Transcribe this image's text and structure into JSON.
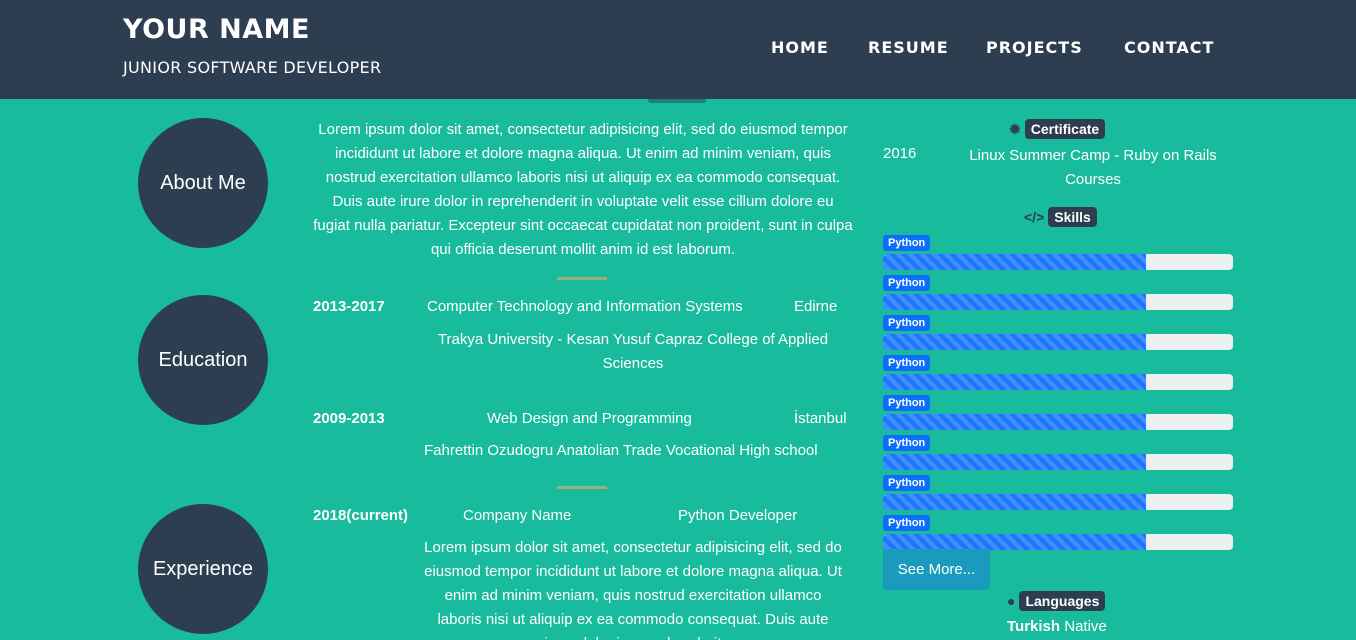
{
  "header": {
    "name": "YOUR NAME",
    "subtitle": "JUNIOR SOFTWARE DEVELOPER",
    "nav": [
      "HOME",
      "RESUME",
      "PROJECTS",
      "CONTACT"
    ]
  },
  "sections": {
    "about": {
      "title": "About Me",
      "text": "Lorem ipsum dolor sit amet, consectetur adipisicing elit, sed do eiusmod tempor incididunt ut labore et dolore magna aliqua. Ut enim ad minim veniam, quis nostrud exercitation ullamco laboris nisi ut aliquip ex ea commodo consequat. Duis aute irure dolor in reprehenderit in voluptate velit esse cillum dolore eu fugiat nulla pariatur. Excepteur sint occaecat cupidatat non proident, sunt in culpa qui officia deserunt mollit anim id est laborum."
    },
    "education": {
      "title": "Education",
      "entries": [
        {
          "years": "2013-2017",
          "program": "Computer Technology and Information Systems",
          "city": "Edirne",
          "school": "Trakya University - Kesan Yusuf Capraz College of Applied Sciences"
        },
        {
          "years": "2009-2013",
          "program": "Web Design and Programming",
          "city": "İstanbul",
          "school": "Fahrettin Ozudogru Anatolian Trade Vocational High school"
        }
      ]
    },
    "experience": {
      "title": "Experience",
      "entries": [
        {
          "years": "2018(current)",
          "company": "Company Name",
          "role": "Python Developer",
          "text": "Lorem ipsum dolor sit amet, consectetur adipisicing elit, sed do eiusmod tempor incididunt ut labore et dolore magna aliqua. Ut enim ad minim veniam, quis nostrud exercitation ullamco laboris nisi ut aliquip ex ea commodo consequat. Duis aute irure dolor in reprehenderit"
        }
      ]
    }
  },
  "sidebar": {
    "certificate": {
      "title": "Certificate",
      "icon": "gear-icon",
      "year": "2016",
      "name": "Linux Summer Camp - Ruby on Rails Courses"
    },
    "skills": {
      "title": "Skills",
      "icon": "code-icon",
      "items": [
        {
          "label": "Python",
          "level": 75
        },
        {
          "label": "Python",
          "level": 75
        },
        {
          "label": "Python",
          "level": 75
        },
        {
          "label": "Python",
          "level": 75
        },
        {
          "label": "Python",
          "level": 75
        },
        {
          "label": "Python",
          "level": 75
        },
        {
          "label": "Python",
          "level": 75
        },
        {
          "label": "Python",
          "level": 75
        }
      ],
      "see_more": "See More..."
    },
    "languages": {
      "title": "Languages",
      "icon": "globe-icon",
      "items": [
        {
          "name": "Turkish",
          "level": "Native"
        }
      ]
    }
  },
  "colors": {
    "accent": "#18bc9c",
    "primary": "#2c3e50",
    "progress": "#1a75ff",
    "badge_blue": "#0d6efd",
    "button": "#1a9bbd"
  }
}
